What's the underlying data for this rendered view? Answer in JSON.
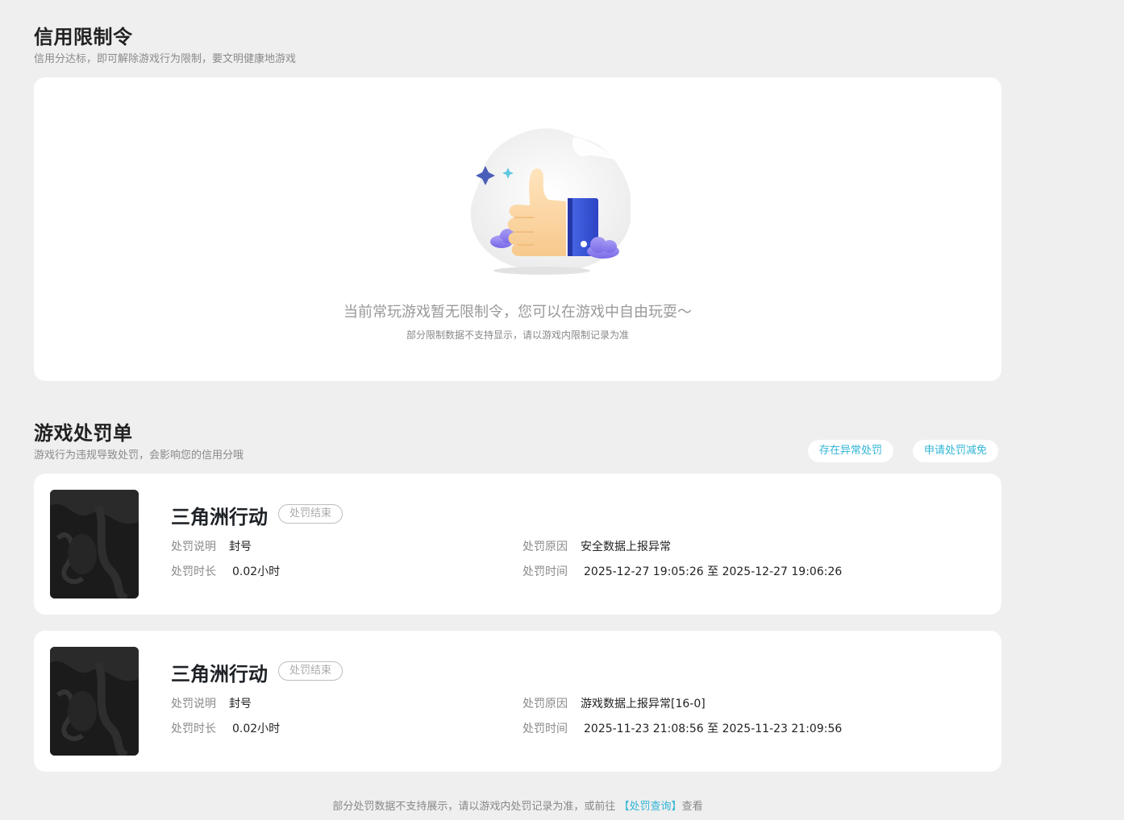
{
  "restriction": {
    "title": "信用限制令",
    "subtitle": "信用分达标，即可解除游戏行为限制，要文明健康地游戏",
    "empty_main": "当前常玩游戏暂无限制令，您可以在游戏中自由玩耍～",
    "empty_sub": "部分限制数据不支持显示，请以游戏内限制记录为准",
    "illustration_icon": "thumbs-up-illustration"
  },
  "penalty": {
    "title": "游戏处罚单",
    "subtitle": "游戏行为违规导致处罚，会影响您的信用分哦",
    "btn_abnormal": "存在异常处罚",
    "btn_reduce": "申请处罚减免",
    "labels": {
      "desc": "处罚说明",
      "duration": "处罚时长",
      "reason": "处罚原因",
      "time": "处罚时间"
    },
    "items": [
      {
        "game": "三角洲行动",
        "status": "处罚结束",
        "desc": "封号",
        "duration": "0.02小时",
        "reason": "安全数据上报异常",
        "time": "2025-12-27 19:05:26 至 2025-12-27 19:06:26"
      },
      {
        "game": "三角洲行动",
        "status": "处罚结束",
        "desc": "封号",
        "duration": "0.02小时",
        "reason": "游戏数据上报异常[16-0]",
        "time": "2025-11-23 21:08:56 至 2025-11-23 21:09:56"
      }
    ]
  },
  "footer": {
    "prefix": "部分处罚数据不支持展示，请以游戏内处罚记录为准，或前往 ",
    "link": "【处罚查询】",
    "suffix": "查看"
  },
  "colors": {
    "accent": "#30b5d6",
    "background": "#efefef",
    "card": "#ffffff"
  }
}
